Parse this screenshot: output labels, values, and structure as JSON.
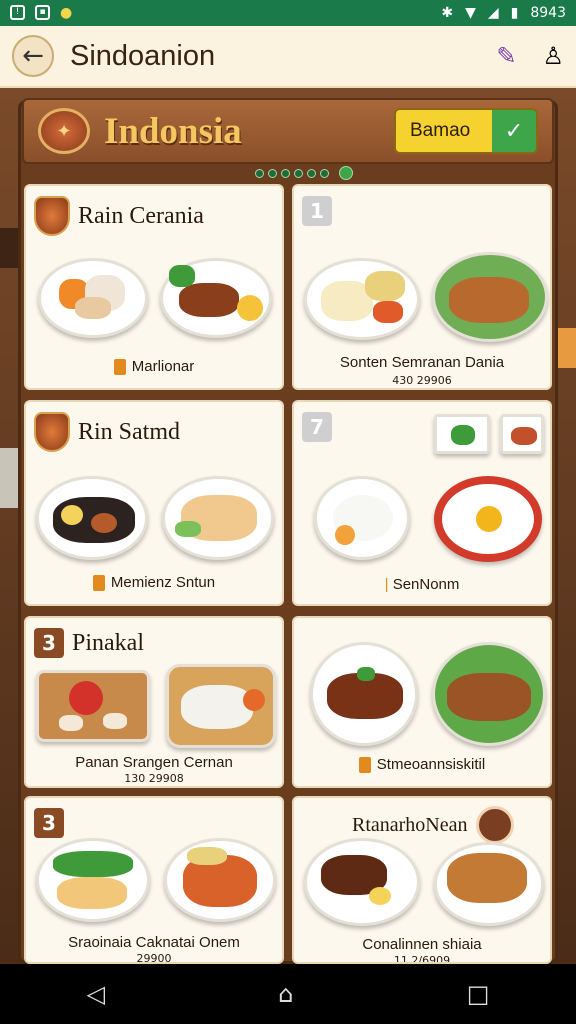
{
  "status_bar": {
    "time": "8943"
  },
  "app_bar": {
    "title": "Sindoanion"
  },
  "banner": {
    "title": "Indonsia",
    "select_value": "Bamao"
  },
  "cards": [
    {
      "badge": "",
      "title": "Rain Cerania",
      "caption": "Marlionar",
      "subcaption": ""
    },
    {
      "badge": "1",
      "title": "",
      "caption": "Sonten  Semranan Dania",
      "subcaption": "430 29906"
    },
    {
      "badge": "",
      "title": "Rin Satmd",
      "caption": "Memienz Sntun",
      "subcaption": ""
    },
    {
      "badge": "7",
      "title": "",
      "caption": "SenNonm",
      "subcaption": ""
    },
    {
      "badge": "3",
      "title": "Pinakal",
      "caption": "Panan  Srangen Cernan",
      "subcaption": "130 29908"
    },
    {
      "badge": "",
      "title": "",
      "caption": "Stmeoannsiskitil",
      "subcaption": ""
    },
    {
      "badge": "3",
      "title": "",
      "caption": "Sraoinaia  Caknatai Onem",
      "subcaption": "29900"
    },
    {
      "badge": "",
      "title": "RtanarhoNean",
      "caption": "Conalinnen shiaia",
      "subcaption": "11 2/6909"
    }
  ]
}
